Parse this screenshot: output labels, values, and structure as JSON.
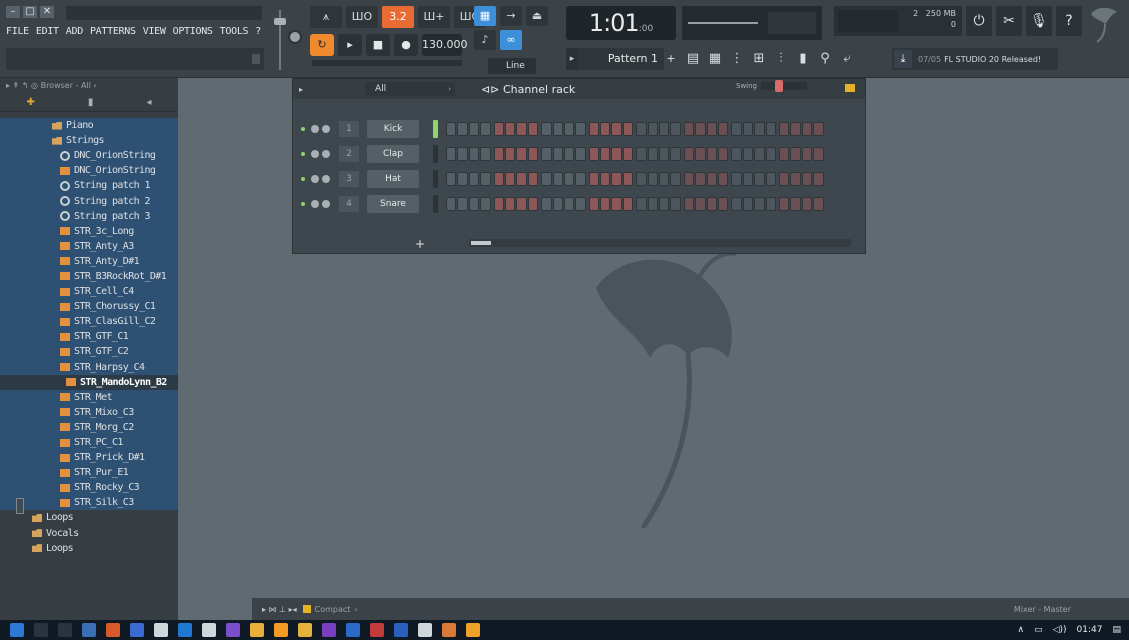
{
  "window": {
    "controls": [
      "–",
      "□",
      "✕"
    ]
  },
  "menu": [
    "FILE",
    "EDIT",
    "ADD",
    "PATTERNS",
    "VIEW",
    "OPTIONS",
    "TOOLS",
    "?"
  ],
  "toolbar": {
    "mode_icons": [
      "⩚",
      "ШО",
      "3.2",
      "Ш+",
      "ШО"
    ],
    "transport": {
      "pattern_song": "↻",
      "play": "▸",
      "stop": "■",
      "record": "●"
    },
    "tempo": "130.000",
    "snap": "Line",
    "song_position": {
      "main": "1:01",
      "sub": ":00"
    },
    "perf": {
      "memory": "250 MB",
      "cpu_a": "2",
      "cpu_b": "0"
    },
    "sys_icons": [
      "⏻",
      "✂",
      "🎙",
      "?"
    ],
    "pattern": "Pattern 1",
    "window_toggles": [
      "▤",
      "▦",
      "⋮",
      "⊞",
      "⫶",
      "▮",
      "⚲",
      "⤶"
    ],
    "news": {
      "date": "07/05",
      "text": "FL STUDIO 20 Released!"
    }
  },
  "browser": {
    "header": "Browser - All",
    "items": [
      {
        "label": "Piano",
        "type": "folder"
      },
      {
        "label": "Strings",
        "type": "folder"
      },
      {
        "label": "DNC_OrionString",
        "type": "preset"
      },
      {
        "label": "DNC_OrionString",
        "type": "sample"
      },
      {
        "label": "String patch 1",
        "type": "preset"
      },
      {
        "label": "String patch 2",
        "type": "preset"
      },
      {
        "label": "String patch 3",
        "type": "preset"
      },
      {
        "label": "STR_3c_Long",
        "type": "sample"
      },
      {
        "label": "STR_Anty_A3",
        "type": "sample"
      },
      {
        "label": "STR_Anty_D#1",
        "type": "sample"
      },
      {
        "label": "STR_B3RockRot_D#1",
        "type": "sample"
      },
      {
        "label": "STR_Cell_C4",
        "type": "sample"
      },
      {
        "label": "STR_Chorussy_C1",
        "type": "sample"
      },
      {
        "label": "STR_ClasGill_C2",
        "type": "sample"
      },
      {
        "label": "STR_GTF_C1",
        "type": "sample"
      },
      {
        "label": "STR_GTF_C2",
        "type": "sample"
      },
      {
        "label": "STR_Harpsy_C4",
        "type": "sample"
      },
      {
        "label": "STR_MandoLynn_B2",
        "type": "sample",
        "selected": true
      },
      {
        "label": "STR_Met",
        "type": "sample"
      },
      {
        "label": "STR_Mixo_C3",
        "type": "sample"
      },
      {
        "label": "STR_Morg_C2",
        "type": "sample"
      },
      {
        "label": "STR_PC_C1",
        "type": "sample"
      },
      {
        "label": "STR_Prick_D#1",
        "type": "sample"
      },
      {
        "label": "STR_Pur_E1",
        "type": "sample"
      },
      {
        "label": "STR_Rocky_C3",
        "type": "sample"
      },
      {
        "label": "STR_Silk_C3",
        "type": "sample"
      },
      {
        "label": "Loops",
        "type": "root"
      },
      {
        "label": "Vocals",
        "type": "root"
      },
      {
        "label": "Loops",
        "type": "root"
      }
    ]
  },
  "channel_rack": {
    "title": "Channel rack",
    "filter": "All",
    "swing_label": "Swing",
    "add_label": "+",
    "channels": [
      {
        "number": "1",
        "name": "Kick",
        "selected": true
      },
      {
        "number": "2",
        "name": "Clap",
        "selected": false
      },
      {
        "number": "3",
        "name": "Hat",
        "selected": false
      },
      {
        "number": "4",
        "name": "Snare",
        "selected": false
      }
    ]
  },
  "bottombar": {
    "view": "Compact",
    "mixer": "Mixer - Master"
  },
  "taskbar": {
    "time": "01:47"
  },
  "colors": {
    "accent_orange": "#f08a2c",
    "accent_blue": "#3c8fd8",
    "browser_highlight": "#2e5073",
    "step_red": "#8e5757"
  }
}
